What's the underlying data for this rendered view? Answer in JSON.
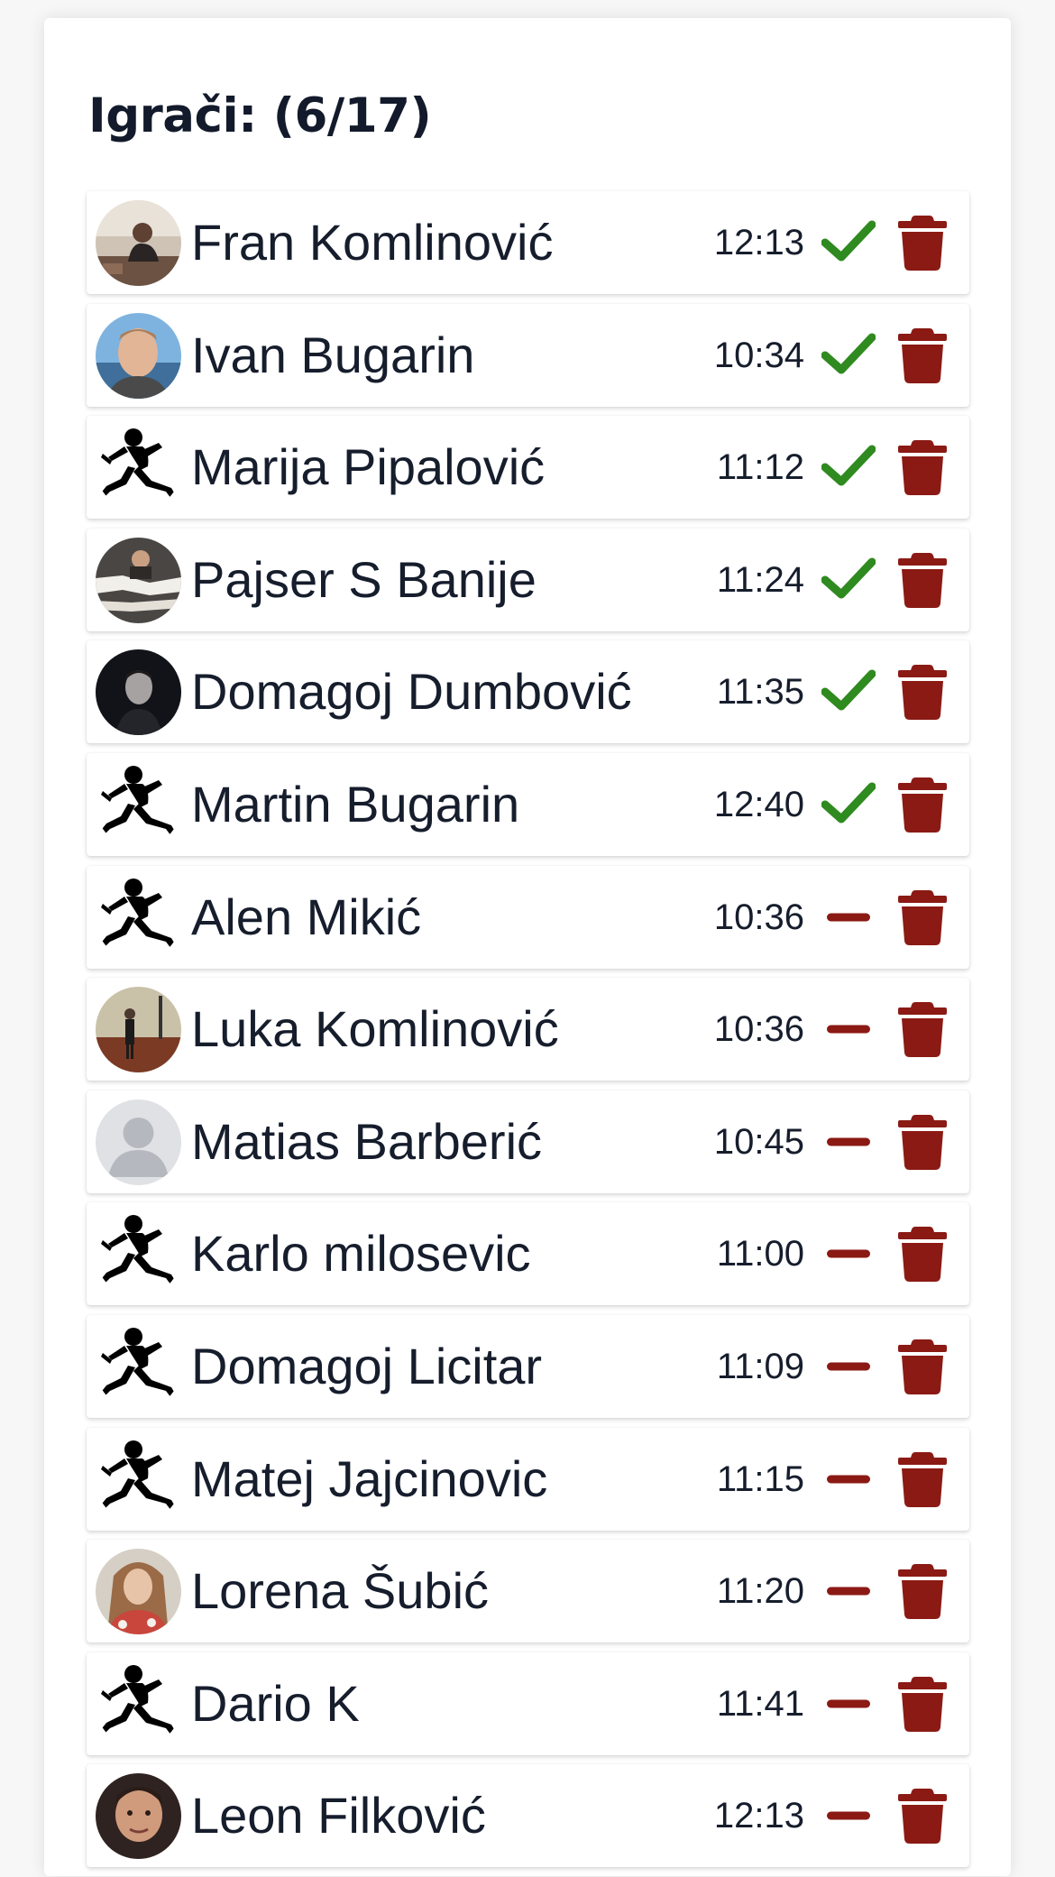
{
  "header": {
    "title": "Igrači: (6/17)"
  },
  "colors": {
    "confirmed": "#2f8a1f",
    "pending": "#8b1a14",
    "trash": "#8b1a14"
  },
  "players": [
    {
      "name": "Fran Komlinović",
      "time": "12:13",
      "status": "confirmed",
      "avatar": "photo-man-desk",
      "status_icon": "checkmark-icon",
      "delete_icon": "trash-icon"
    },
    {
      "name": "Ivan Bugarin",
      "time": "10:34",
      "status": "confirmed",
      "avatar": "photo-man-sea",
      "status_icon": "checkmark-icon",
      "delete_icon": "trash-icon"
    },
    {
      "name": "Marija Pipalović",
      "time": "11:12",
      "status": "confirmed",
      "avatar": "runner-silhouette",
      "status_icon": "checkmark-icon",
      "delete_icon": "trash-icon"
    },
    {
      "name": "Pajser S Banije",
      "time": "11:24",
      "status": "confirmed",
      "avatar": "photo-torn-paper",
      "status_icon": "checkmark-icon",
      "delete_icon": "trash-icon"
    },
    {
      "name": "Domagoj Dumbović",
      "time": "11:35",
      "status": "confirmed",
      "avatar": "photo-dark-face",
      "status_icon": "checkmark-icon",
      "delete_icon": "trash-icon"
    },
    {
      "name": "Martin Bugarin",
      "time": "12:40",
      "status": "confirmed",
      "avatar": "runner-silhouette",
      "status_icon": "checkmark-icon",
      "delete_icon": "trash-icon"
    },
    {
      "name": "Alen Mikić",
      "time": "10:36",
      "status": "pending",
      "avatar": "runner-silhouette",
      "status_icon": "minus-icon",
      "delete_icon": "trash-icon"
    },
    {
      "name": "Luka Komlinović",
      "time": "10:36",
      "status": "pending",
      "avatar": "photo-court",
      "status_icon": "minus-icon",
      "delete_icon": "trash-icon"
    },
    {
      "name": "Matias Barberić",
      "time": "10:45",
      "status": "pending",
      "avatar": "default-user",
      "status_icon": "minus-icon",
      "delete_icon": "trash-icon"
    },
    {
      "name": "Karlo milosevic",
      "time": "11:00",
      "status": "pending",
      "avatar": "runner-silhouette",
      "status_icon": "minus-icon",
      "delete_icon": "trash-icon"
    },
    {
      "name": "Domagoj Licitar",
      "time": "11:09",
      "status": "pending",
      "avatar": "runner-silhouette",
      "status_icon": "minus-icon",
      "delete_icon": "trash-icon"
    },
    {
      "name": "Matej Jajcinovic",
      "time": "11:15",
      "status": "pending",
      "avatar": "runner-silhouette",
      "status_icon": "minus-icon",
      "delete_icon": "trash-icon"
    },
    {
      "name": "Lorena Šubić",
      "time": "11:20",
      "status": "pending",
      "avatar": "photo-woman",
      "status_icon": "minus-icon",
      "delete_icon": "trash-icon"
    },
    {
      "name": "Dario K",
      "time": "11:41",
      "status": "pending",
      "avatar": "runner-silhouette",
      "status_icon": "minus-icon",
      "delete_icon": "trash-icon"
    },
    {
      "name": "Leon Filković",
      "time": "12:13",
      "status": "pending",
      "avatar": "photo-young-man",
      "status_icon": "minus-icon",
      "delete_icon": "trash-icon"
    }
  ]
}
